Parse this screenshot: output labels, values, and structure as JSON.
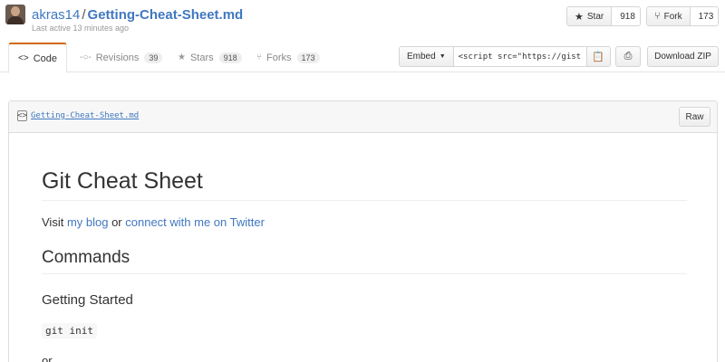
{
  "header": {
    "owner": "akras14",
    "separator": "/",
    "gist_name": "Getting-Cheat-Sheet.md",
    "last_active": "Last active 13 minutes ago",
    "star_label": "Star",
    "star_count": "918",
    "fork_label": "Fork",
    "fork_count": "173"
  },
  "tabs": [
    {
      "label": "Code",
      "icon": "code-icon"
    },
    {
      "label": "Revisions",
      "count": "39",
      "icon": "revisions-icon"
    },
    {
      "label": "Stars",
      "count": "918",
      "icon": "star-icon"
    },
    {
      "label": "Forks",
      "count": "173",
      "icon": "fork-icon"
    }
  ],
  "actions": {
    "embed_label": "Embed",
    "embed_value": "<script src=\"https://gist.",
    "download_label": "Download ZIP"
  },
  "file": {
    "name": "Getting-Cheat-Sheet.md",
    "raw_label": "Raw"
  },
  "content": {
    "h1": "Git Cheat Sheet",
    "visit_prefix": "Visit ",
    "blog_link": "my blog",
    "or_text": " or ",
    "twitter_link": "connect with me on Twitter",
    "h2": "Commands",
    "h3": "Getting Started",
    "code": "git init",
    "or_line": "or"
  }
}
